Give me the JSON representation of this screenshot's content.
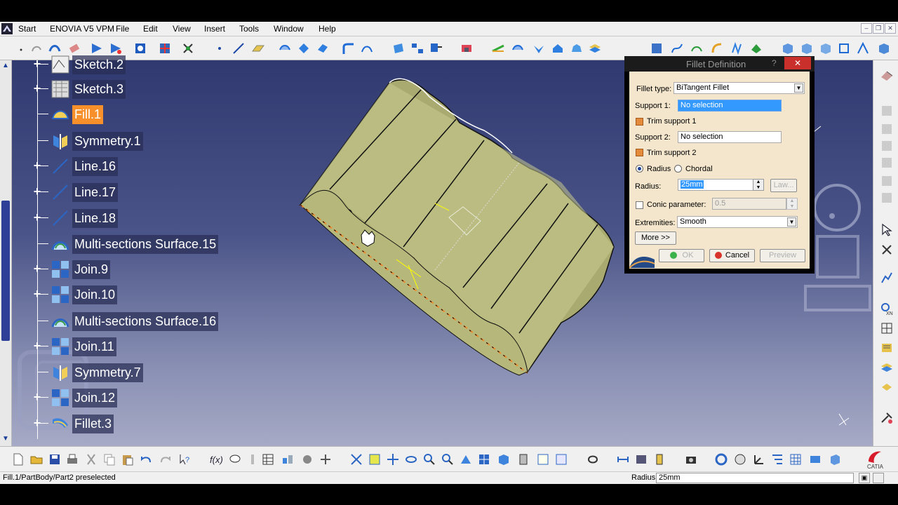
{
  "menubar": {
    "start": "Start",
    "items": [
      "ENOVIA V5 VPM",
      "File",
      "Edit",
      "View",
      "Insert",
      "Tools",
      "Window",
      "Help"
    ]
  },
  "tree": {
    "items": [
      {
        "label": "Sketch.2",
        "icon": "sketch-icon",
        "expandable": true,
        "selected": false
      },
      {
        "label": "Sketch.3",
        "icon": "sketch-icon",
        "expandable": true,
        "selected": false
      },
      {
        "label": "Fill.1",
        "icon": "fill-icon",
        "expandable": false,
        "selected": true
      },
      {
        "label": "Symmetry.1",
        "icon": "symmetry-icon",
        "expandable": false,
        "selected": false
      },
      {
        "label": "Line.16",
        "icon": "line-icon",
        "expandable": true,
        "selected": false
      },
      {
        "label": "Line.17",
        "icon": "line-icon",
        "expandable": true,
        "selected": false
      },
      {
        "label": "Line.18",
        "icon": "line-icon",
        "expandable": true,
        "selected": false
      },
      {
        "label": "Multi-sections Surface.15",
        "icon": "multi-sections-surface-icon",
        "expandable": false,
        "selected": false
      },
      {
        "label": "Join.9",
        "icon": "join-icon",
        "expandable": true,
        "selected": false
      },
      {
        "label": "Join.10",
        "icon": "join-icon",
        "expandable": true,
        "selected": false
      },
      {
        "label": "Multi-sections Surface.16",
        "icon": "multi-sections-surface-icon",
        "expandable": false,
        "selected": false
      },
      {
        "label": "Join.11",
        "icon": "join-icon",
        "expandable": true,
        "selected": false
      },
      {
        "label": "Symmetry.7",
        "icon": "symmetry-icon",
        "expandable": false,
        "selected": false
      },
      {
        "label": "Join.12",
        "icon": "join-icon",
        "expandable": true,
        "selected": false
      },
      {
        "label": "Fillet.3",
        "icon": "fillet-icon",
        "expandable": true,
        "selected": false
      }
    ]
  },
  "dialog": {
    "title": "Fillet Definition",
    "help": "?",
    "close": "✕",
    "fillet_type_label": "Fillet type:",
    "fillet_type_value": "BiTangent Fillet",
    "support1_label": "Support 1:",
    "support1_value": "No selection",
    "trim1_label": "Trim support 1",
    "support2_label": "Support 2:",
    "support2_value": "No selection",
    "trim2_label": "Trim support 2",
    "radius_option": "Radius",
    "chordal_option": "Chordal",
    "radius_label": "Radius:",
    "radius_value": "25mm",
    "law_button": "Law...",
    "conic_label": "Conic parameter:",
    "conic_value": "0.5",
    "extremities_label": "Extremities:",
    "extremities_value": "Smooth",
    "more_button": "More >>",
    "ok_button": "OK",
    "cancel_button": "Cancel",
    "preview_button": "Preview"
  },
  "statusbar": {
    "message": "Fill.1/PartBody/Part2 preselected",
    "radius_label": "Radius",
    "radius_value": "25mm"
  },
  "colors": {
    "selection": "#f7902a",
    "surface": "#c8c98e",
    "dialog_bg": "#f3e6cc",
    "highlight_field": "#3399ff"
  }
}
